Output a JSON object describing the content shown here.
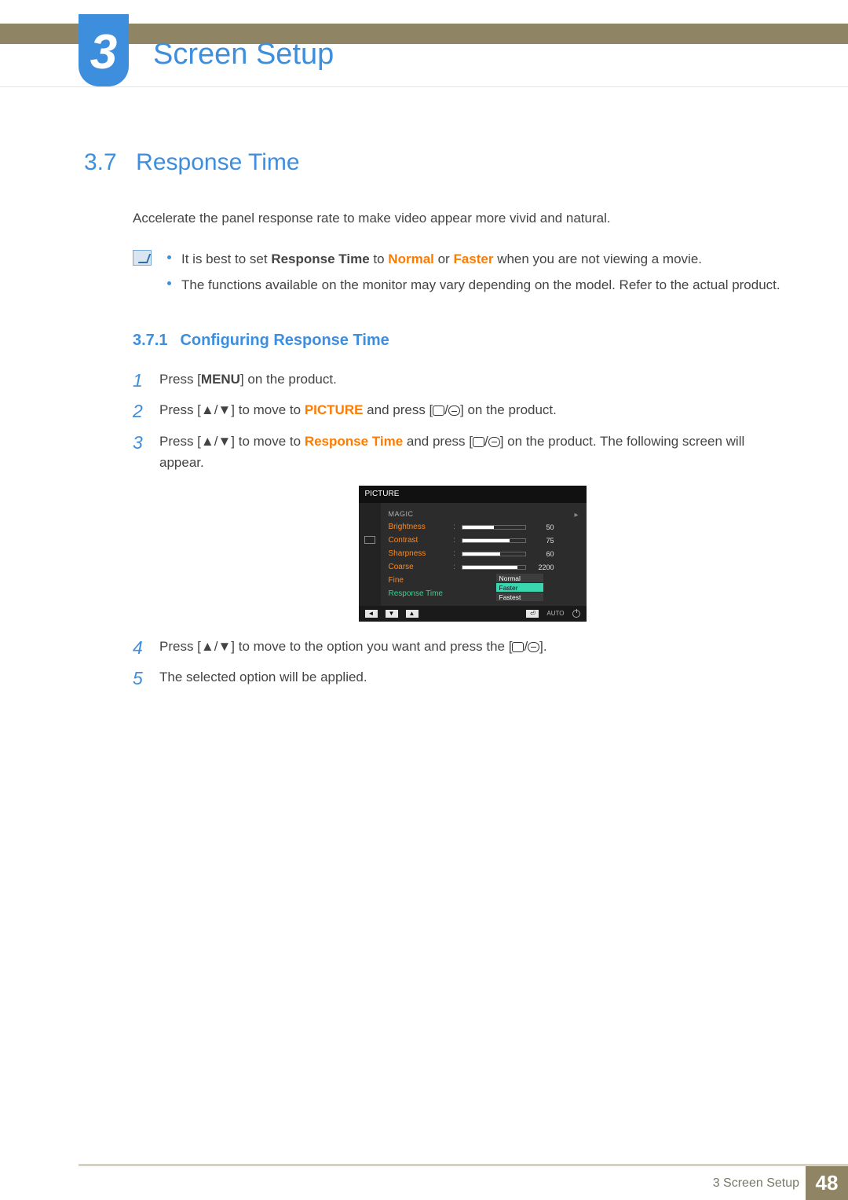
{
  "chapter": {
    "number": "3",
    "title": "Screen Setup"
  },
  "section": {
    "number": "3.7",
    "title": "Response Time"
  },
  "intro": "Accelerate the panel response rate to make video appear more vivid and natural.",
  "note": {
    "line1_pre": "It is best to set ",
    "line1_rt": "Response Time",
    "line1_to": " to ",
    "line1_normal": "Normal",
    "line1_or": " or ",
    "line1_faster": "Faster",
    "line1_post": " when you are not viewing a movie.",
    "line2": "The functions available on the monitor may vary depending on the model. Refer to the actual product."
  },
  "subsection": {
    "number": "3.7.1",
    "title": "Configuring Response Time"
  },
  "steps": {
    "s1_pre": "Press [",
    "s1_menu": "MENU",
    "s1_post": "] on the product.",
    "s2_a": "Press [▲/▼] to move to ",
    "s2_picture": "PICTURE",
    "s2_b": " and press [",
    "s2_c": "] on the product.",
    "s3_a": "Press [▲/▼] to move to ",
    "s3_rt": "Response Time",
    "s3_b": " and press [",
    "s3_c": "] on the product. The following screen will appear.",
    "s4_a": "Press [▲/▼] to move to the option you want and press the [",
    "s4_b": "].",
    "s5": "The selected option will be applied."
  },
  "osd": {
    "title": "PICTURE",
    "magic": "MAGIC",
    "rows": [
      {
        "label": "Brightness",
        "value": "50",
        "fill": 50
      },
      {
        "label": "Contrast",
        "value": "75",
        "fill": 75
      },
      {
        "label": "Sharpness",
        "value": "60",
        "fill": 60
      },
      {
        "label": "Coarse",
        "value": "2200",
        "fill": 88
      }
    ],
    "fine": "Fine",
    "rt_label": "Response Time",
    "options": [
      "Normal",
      "Faster",
      "Fastest"
    ],
    "auto": "AUTO"
  },
  "footer": {
    "label": "3 Screen Setup",
    "page": "48"
  }
}
